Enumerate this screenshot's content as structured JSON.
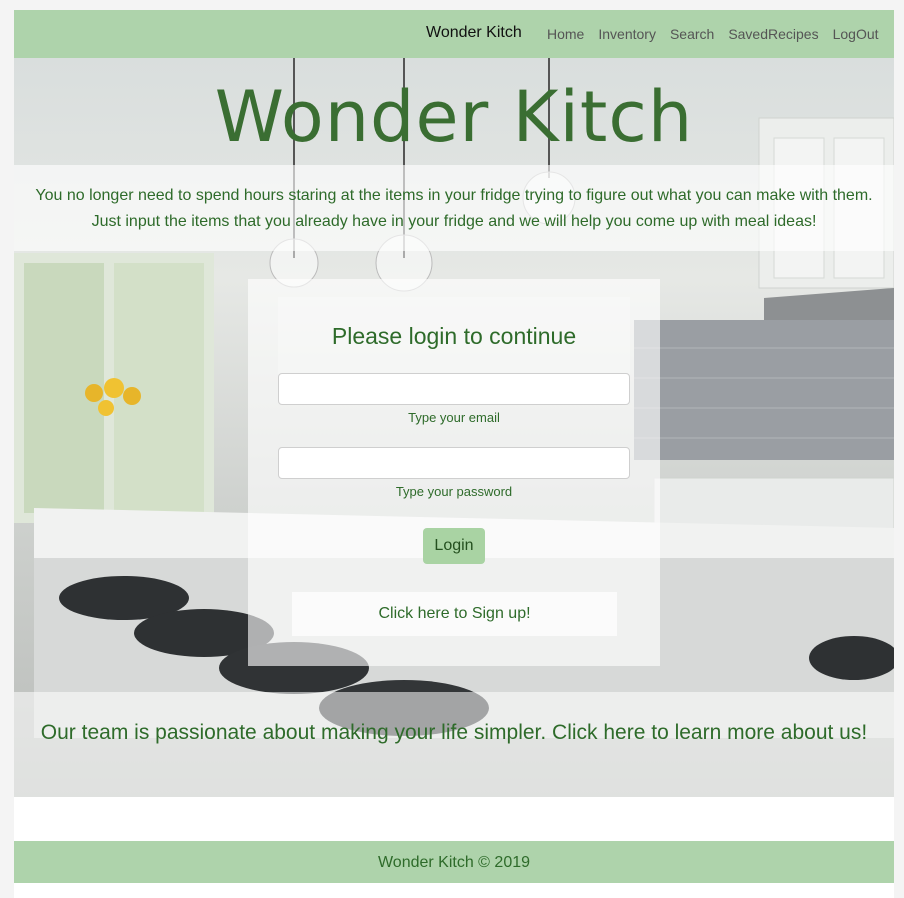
{
  "navbar": {
    "brand": "Wonder Kitch",
    "links": [
      "Home",
      "Inventory",
      "Search",
      "SavedRecipes",
      "LogOut"
    ]
  },
  "hero": {
    "title": "Wonder Kitch",
    "intro": "You no longer need to spend hours staring at the items in your fridge trying to figure out what you can make with them. Just input the items that you already have in your fridge and we will help you come up with meal ideas!"
  },
  "login": {
    "title": "Please login to continue",
    "email_help": "Type your email",
    "password_help": "Type your password",
    "button": "Login",
    "signup": "Click here to Sign up!"
  },
  "about": {
    "text": "Our team is passionate about making your life simpler. Click here to learn more about us!"
  },
  "footer": {
    "text": "Wonder Kitch © 2019"
  },
  "colors": {
    "navbar_bg": "#aed3ab",
    "accent_green": "#2e6b2a",
    "title_green": "#3a6e32",
    "button_bg": "#a9d3a3"
  }
}
